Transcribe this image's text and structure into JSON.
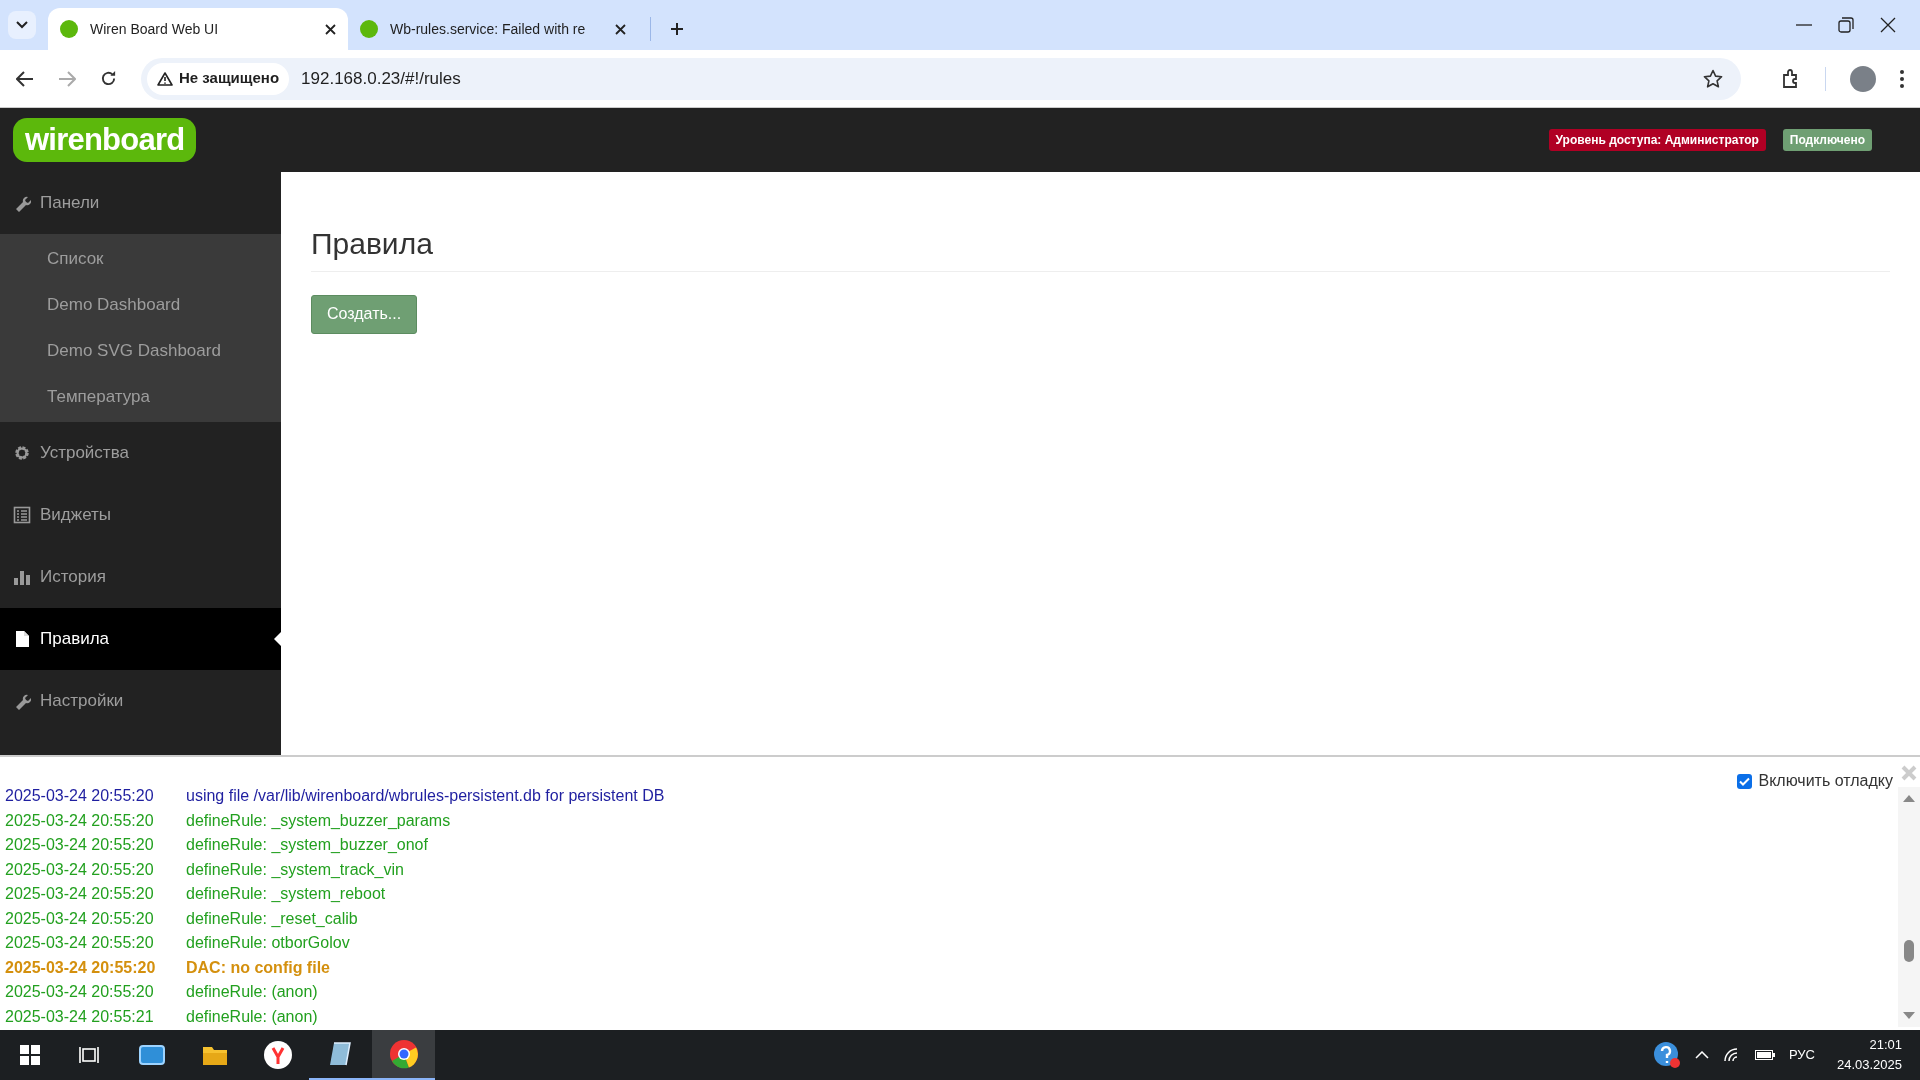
{
  "browser": {
    "tabs": [
      {
        "title": "Wiren Board Web UI",
        "selected": true
      },
      {
        "title": "Wb-rules.service: Failed with re",
        "selected": false
      }
    ],
    "address": {
      "security": "Не защищено",
      "url": "192.168.0.23/#!/rules"
    }
  },
  "header": {
    "logo": "wirenboard",
    "badges": [
      {
        "text": "Уровень доступа: Администратор",
        "kind": "danger"
      },
      {
        "text": "Подключено",
        "kind": "success"
      }
    ]
  },
  "sidebar": {
    "items": [
      {
        "label": "Панели",
        "selected": false,
        "children": [
          {
            "label": "Список"
          },
          {
            "label": "Demo Dashboard"
          },
          {
            "label": "Demo SVG Dashboard"
          },
          {
            "label": "Температура"
          }
        ]
      },
      {
        "label": "Устройства",
        "selected": false
      },
      {
        "label": "Виджеты",
        "selected": false
      },
      {
        "label": "История",
        "selected": false
      },
      {
        "label": "Правила",
        "selected": true
      },
      {
        "label": "Настройки",
        "selected": false
      }
    ]
  },
  "page": {
    "title": "Правила",
    "create_button": "Создать..."
  },
  "log": {
    "debug_toggle": {
      "label": "Включить отладку",
      "checked": true
    },
    "entries": [
      {
        "time": "2025-03-24 20:55:20",
        "message": "using file /var/lib/wirenboard/wbrules-persistent.db for persistent DB",
        "kind": "info"
      },
      {
        "time": "2025-03-24 20:55:20",
        "message": "defineRule: _system_buzzer_params",
        "kind": "debug"
      },
      {
        "time": "2025-03-24 20:55:20",
        "message": "defineRule: _system_buzzer_onof",
        "kind": "debug"
      },
      {
        "time": "2025-03-24 20:55:20",
        "message": "defineRule: _system_track_vin",
        "kind": "debug"
      },
      {
        "time": "2025-03-24 20:55:20",
        "message": "defineRule: _system_reboot",
        "kind": "debug"
      },
      {
        "time": "2025-03-24 20:55:20",
        "message": "defineRule: _reset_calib",
        "kind": "debug"
      },
      {
        "time": "2025-03-24 20:55:20",
        "message": "defineRule: otborGolov",
        "kind": "debug"
      },
      {
        "time": "2025-03-24 20:55:20",
        "message": "DAC: no config file",
        "kind": "warning"
      },
      {
        "time": "2025-03-24 20:55:20",
        "message": "defineRule: (anon)",
        "kind": "debug"
      },
      {
        "time": "2025-03-24 20:55:21",
        "message": "defineRule: (anon)",
        "kind": "debug"
      }
    ]
  },
  "taskbar": {
    "language": "РУС",
    "time": "21:01",
    "date": "24.03.2025"
  }
}
